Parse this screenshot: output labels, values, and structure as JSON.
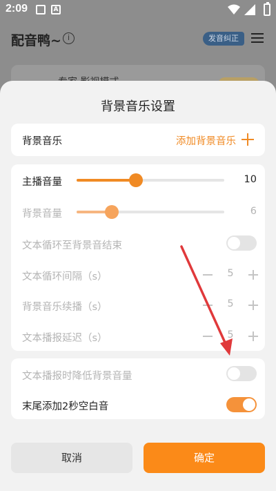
{
  "status": {
    "time": "2:09"
  },
  "app": {
    "title": "配音鸭~",
    "badge": "发音纠正",
    "card_text": "专家 影视模式"
  },
  "sheet": {
    "title": "背景音乐设置",
    "bg_music": {
      "label": "背景音乐",
      "action": "添加背景音乐"
    },
    "main_volume": {
      "label": "主播音量",
      "value": "10",
      "fraction": 0.4
    },
    "bg_volume": {
      "label": "背景音量",
      "value": "6",
      "fraction": 0.24
    },
    "loop_until_end": {
      "label": "文本循环至背景音结束",
      "on": false
    },
    "loop_interval": {
      "label": "文本循环间隔（s）",
      "value": "5"
    },
    "bg_continue": {
      "label": "背景音乐续播（s）",
      "value": "5"
    },
    "play_delay": {
      "label": "文本播报延迟（s）",
      "value": "5"
    },
    "duck_bg": {
      "label": "文本播报时降低背景音量",
      "on": false
    },
    "tail_silence": {
      "label": "末尾添加2秒空白音",
      "on": true
    },
    "cancel": "取消",
    "confirm": "确定"
  },
  "colors": {
    "accent": "#f08a24",
    "confirm": "#fb8a18",
    "annotation": "#e0393b"
  }
}
